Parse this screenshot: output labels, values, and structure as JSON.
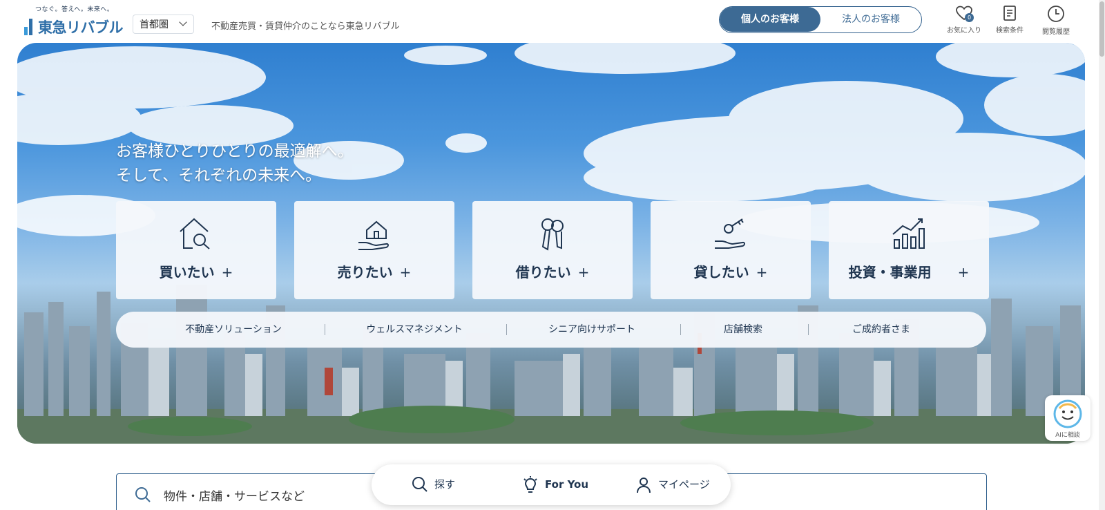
{
  "header": {
    "tagline": "つなぐ。答えへ。未来へ。",
    "logo_name": "東急リバブル",
    "region": "首都圏",
    "description": "不動産売買・賃貸仲介のことなら東急リバブル",
    "customer_tabs": {
      "personal": "個人のお客様",
      "corporate": "法人のお客様"
    },
    "favorites_label": "お気に入り",
    "favorites_count": "0",
    "search_conditions_label": "検索条件",
    "history_label": "閲覧履歴"
  },
  "hero": {
    "headline_line1": "お客様ひとりひとりの最適解へ。",
    "headline_line2": "そして、それぞれの未来へ。",
    "cards": [
      {
        "label": "買いたい",
        "icon": "house-search-icon"
      },
      {
        "label": "売りたい",
        "icon": "house-hand-icon"
      },
      {
        "label": "借りたい",
        "icon": "keys-icon"
      },
      {
        "label": "貸したい",
        "icon": "key-hand-icon"
      },
      {
        "label": "投資・事業用",
        "icon": "growth-chart-icon"
      }
    ],
    "plus": "+",
    "subnav": [
      "不動産ソリューション",
      "ウェルスマネジメント",
      "シニア向けサポート",
      "店舗検索",
      "ご成約者さま"
    ],
    "ai_label": "AIに相談"
  },
  "search": {
    "placeholder": "物件・店舗・サービスなど"
  },
  "bottom_nav": {
    "search": "探す",
    "for_you": "For You",
    "mypage": "マイページ"
  },
  "colors": {
    "brand_navy": "#1f3550",
    "brand_blue": "#3d6a94",
    "logo_blue": "#2f6fa8"
  }
}
